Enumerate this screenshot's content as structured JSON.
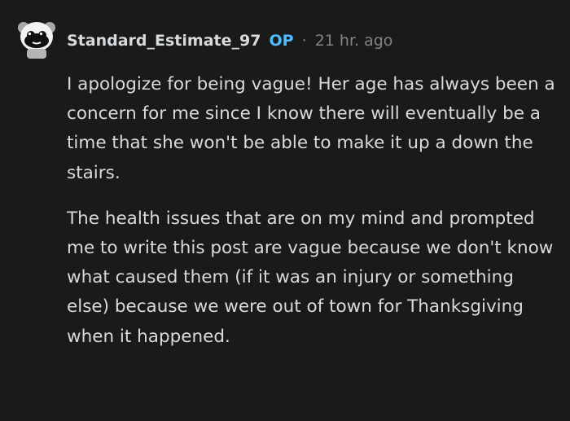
{
  "comment": {
    "author": {
      "username": "Standard_Estimate_97",
      "badge": "OP",
      "separator": "·",
      "timestamp": "21 hr. ago"
    },
    "paragraphs": [
      "I apologize for being vague! Her age has always been a concern for me since I know there will eventually be a time that she won't be able to make it up a down the stairs.",
      "The health issues that are on my mind and prompted me to write this post are vague because we don't know what caused them (if it was an injury or something else) because we were out of town for Thanksgiving when it happened."
    ]
  },
  "colors": {
    "background": "#1a1a1b",
    "text": "#d7dadc",
    "meta": "#818384",
    "op_badge": "#4fbcff"
  },
  "icons": {
    "avatar": "snoo-avatar-icon"
  }
}
